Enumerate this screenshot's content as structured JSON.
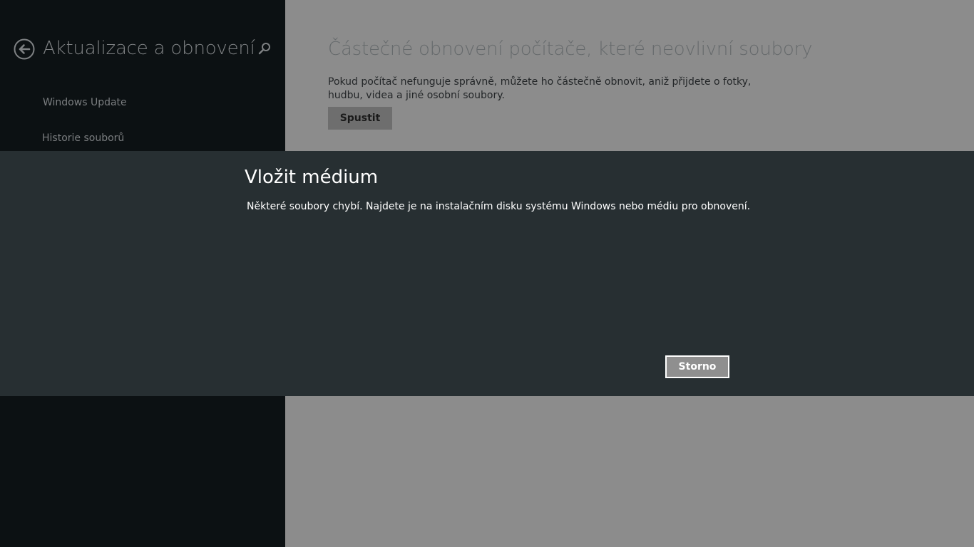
{
  "nav": {
    "title": "Aktualizace a obnovení",
    "back_icon": "back-arrow-circle-icon",
    "search_icon": "search-icon",
    "items": [
      {
        "label": "Windows Update"
      },
      {
        "label": "Historie souborů"
      }
    ]
  },
  "content": {
    "title": "Částečné obnovení počítače, které neovlivní soubory",
    "description": "Pokud počítač nefunguje správně, můžete ho částečně obnovit, aniž přijdete o fotky, hudbu, videa a jiné osobní soubory.",
    "start_button": "Spustit"
  },
  "dialog": {
    "title": "Vložit médium",
    "message": "Některé soubory chybí. Najdete je na instalačním disku systému Windows nebo médiu pro obnovení.",
    "cancel_button": "Storno"
  },
  "colors": {
    "nav_background": "#0c1113",
    "content_background_dimmed": "#8c8c8c",
    "dialog_background": "#272f32",
    "dialog_text": "#ffffff",
    "cancel_button_background": "#8f8f8f"
  }
}
